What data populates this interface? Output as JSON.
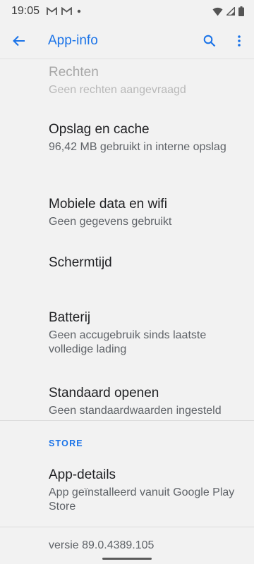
{
  "status_bar": {
    "time": "19:05",
    "icons": [
      "gmail-icon",
      "gmail-icon",
      "notification-dot-icon",
      "wifi-icon",
      "signal-icon",
      "battery-icon"
    ]
  },
  "app_bar": {
    "title": "App-info",
    "accent_color": "#1a73e8"
  },
  "items": [
    {
      "title": "Rechten",
      "subtitle": "Geen rechten aangevraagd",
      "enabled": false
    },
    {
      "title": "Opslag en cache",
      "subtitle": "96,42 MB gebruikt in interne opslag",
      "enabled": true
    },
    {
      "title": "Mobiele data en wifi",
      "subtitle": "Geen gegevens gebruikt",
      "enabled": true
    },
    {
      "title": "Schermtijd",
      "subtitle": "",
      "enabled": true
    },
    {
      "title": "Batterij",
      "subtitle": "Geen accugebruik sinds laatste volledige lading",
      "enabled": true
    },
    {
      "title": "Standaard openen",
      "subtitle": "Geen standaardwaarden ingesteld",
      "enabled": true
    }
  ],
  "store_section": {
    "header": "STORE",
    "items": [
      {
        "title": "App-details",
        "subtitle": "App geïnstalleerd vanuit Google Play Store"
      }
    ]
  },
  "version": "versie 89.0.4389.105"
}
